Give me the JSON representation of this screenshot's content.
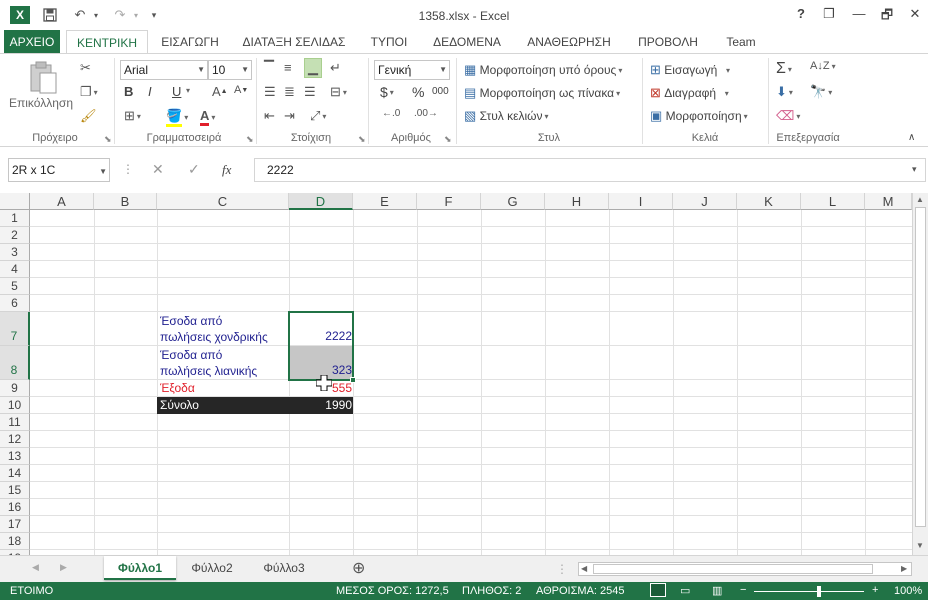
{
  "window": {
    "title": "1358.xlsx - Excel",
    "help": "?",
    "restore": "❐",
    "minimize": "—",
    "maximize": "🗗",
    "close": "✕"
  },
  "qat": {
    "app_icon": "X",
    "customize": "▾"
  },
  "tabs": [
    {
      "label": "ΑΡΧΕΙΟ"
    },
    {
      "label": "ΚΕΝΤΡΙΚΗ"
    },
    {
      "label": "ΕΙΣΑΓΩΓΗ"
    },
    {
      "label": "ΔΙΑΤΑΞΗ ΣΕΛΙΔΑΣ"
    },
    {
      "label": "ΤΥΠΟΙ"
    },
    {
      "label": "ΔΕΔΟΜΕΝΑ"
    },
    {
      "label": "ΑΝΑΘΕΩΡΗΣΗ"
    },
    {
      "label": "ΠΡΟΒΟΛΗ"
    },
    {
      "label": "Team"
    }
  ],
  "ribbon": {
    "clipboard": {
      "paste_label": "Επικόλληση",
      "group_label": "Πρόχειρο"
    },
    "font": {
      "name": "Arial",
      "size": "10",
      "group_label": "Γραμματοσειρά",
      "bold": "B",
      "italic": "I",
      "underline": "U"
    },
    "alignment": {
      "group_label": "Στοίχιση"
    },
    "number": {
      "format": "Γενική",
      "group_label": "Αριθμός",
      "currency": "$",
      "percent": "%",
      "thousands": "000"
    },
    "styles": {
      "conditional": "Μορφοποίηση υπό όρους",
      "as_table": "Μορφοποίηση ως πίνακα",
      "cell_styles": "Στυλ κελιών",
      "group_label": "Στυλ"
    },
    "cells": {
      "insert": "Εισαγωγή",
      "delete": "Διαγραφή",
      "format": "Μορφοποίηση",
      "group_label": "Κελιά"
    },
    "editing": {
      "group_label": "Επεξεργασία"
    }
  },
  "formula_bar": {
    "name_box": "2R x 1C",
    "fx": "fx",
    "value": "2222"
  },
  "columns": [
    "A",
    "B",
    "C",
    "D",
    "E",
    "F",
    "G",
    "H",
    "I",
    "J",
    "K",
    "L",
    "M"
  ],
  "rows": [
    "1",
    "2",
    "3",
    "4",
    "5",
    "6",
    "7",
    "8",
    "9",
    "10",
    "11",
    "12",
    "13",
    "14",
    "15",
    "16",
    "17",
    "18",
    "19"
  ],
  "cells": {
    "c7_line1": "Έσοδα από",
    "c7_line2": "πωλήσεις χονδρικής",
    "d7": "2222",
    "c8_line1": "Έσοδα από",
    "c8_line2": "πωλήσεις λιανικής",
    "d8": "323",
    "c9": "Έξοδα",
    "d9": "555",
    "c10": "Σύνολο",
    "d10": "1990"
  },
  "sheets": [
    {
      "label": "Φύλλο1"
    },
    {
      "label": "Φύλλο2"
    },
    {
      "label": "Φύλλο3"
    }
  ],
  "add_sheet": "⊕",
  "status": {
    "mode": "ΕΤΟΙΜΟ",
    "average": "ΜΕΣΟΣ ΟΡΟΣ: 1272,5",
    "count": "ΠΛΗΘΟΣ: 2",
    "sum": "ΑΘΡΟΙΣΜΑ: 2545",
    "zoom": "100%",
    "zoom_minus": "−",
    "zoom_plus": "+"
  },
  "colors": {
    "accent": "#217346",
    "blue_text": "#1f1f8f",
    "red_text": "#e0202b",
    "dark_fill": "#262626",
    "selection_fill": "#c6c6c6"
  }
}
